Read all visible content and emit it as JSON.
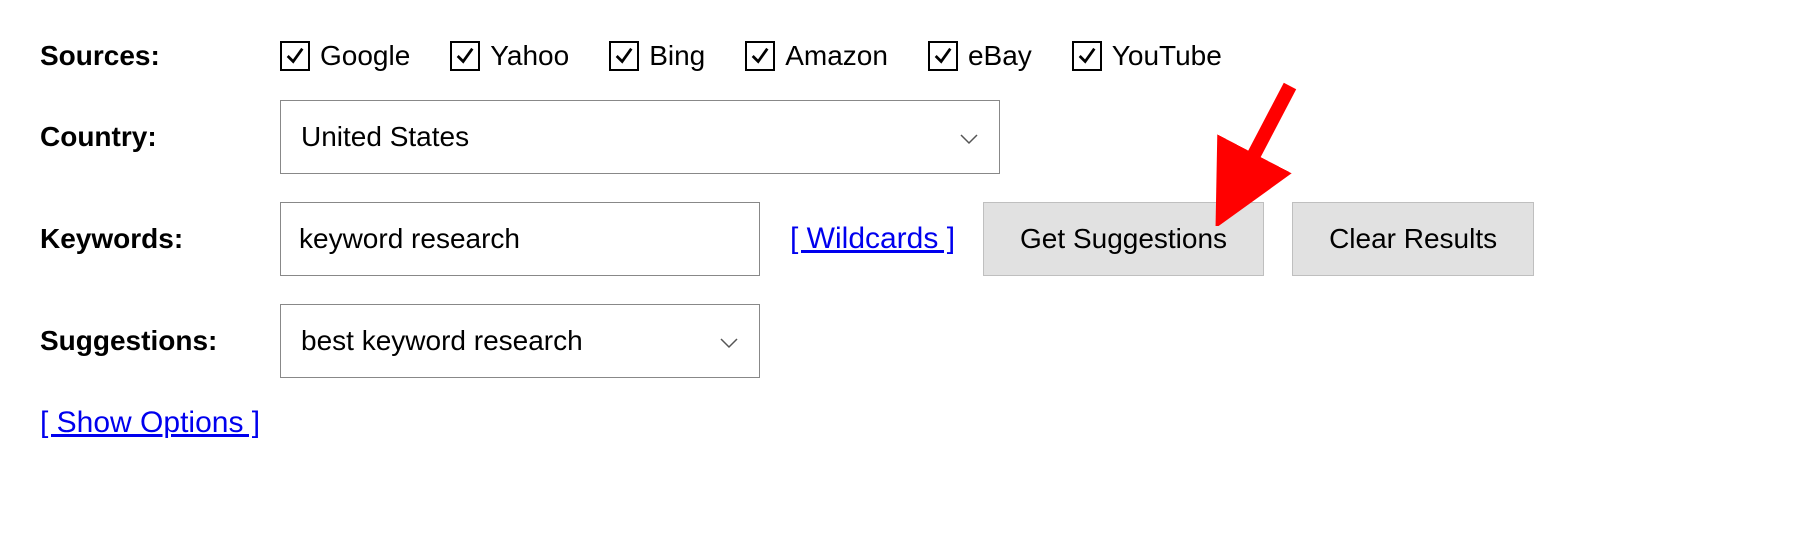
{
  "labels": {
    "sources": "Sources:",
    "country": "Country:",
    "keywords": "Keywords:",
    "suggestions": "Suggestions:"
  },
  "sources": {
    "items": [
      {
        "label": "Google"
      },
      {
        "label": "Yahoo"
      },
      {
        "label": "Bing"
      },
      {
        "label": "Amazon"
      },
      {
        "label": "eBay"
      },
      {
        "label": "YouTube"
      }
    ]
  },
  "country": {
    "selected": "United States"
  },
  "keywords": {
    "value": "keyword research"
  },
  "links": {
    "wildcards": "[ Wildcards ]",
    "show_options": "[ Show Options ]"
  },
  "buttons": {
    "get_suggestions": "Get Suggestions",
    "clear_results": "Clear Results"
  },
  "suggestions": {
    "selected": "best keyword research"
  }
}
